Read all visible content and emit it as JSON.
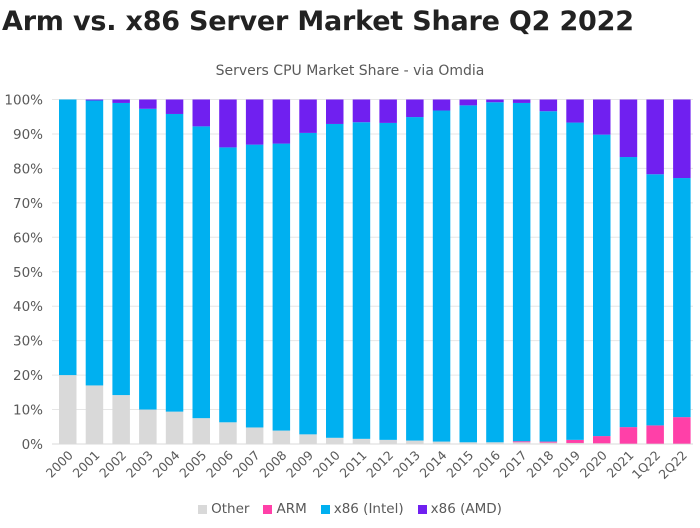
{
  "page": {
    "title": "Arm vs. x86 Server Market Share Q2 2022"
  },
  "chart_data": {
    "type": "bar",
    "stacked": true,
    "title": "Servers CPU Market Share - via Omdia",
    "xlabel": "",
    "ylabel": "",
    "ylim": [
      0,
      100
    ],
    "y_ticks": [
      "0%",
      "10%",
      "20%",
      "30%",
      "40%",
      "50%",
      "60%",
      "70%",
      "80%",
      "90%",
      "100%"
    ],
    "grid": true,
    "legend_position": "bottom",
    "categories": [
      "2000",
      "2001",
      "2002",
      "2003",
      "2004",
      "2005",
      "2006",
      "2007",
      "2008",
      "2009",
      "2010",
      "2011",
      "2012",
      "2013",
      "2014",
      "2015",
      "2016",
      "2017",
      "2018",
      "2019",
      "2020",
      "2021",
      "1Q22",
      "2Q22"
    ],
    "series": [
      {
        "name": "Other",
        "color": "#d9d9d9",
        "values": [
          20,
          17,
          14.2,
          10,
          9.4,
          7.5,
          6.3,
          4.8,
          3.9,
          2.8,
          1.8,
          1.5,
          1.2,
          1.0,
          0.7,
          0.5,
          0.5,
          0.5,
          0.4,
          0.3,
          0.2,
          0.1,
          0.1,
          0.1
        ]
      },
      {
        "name": "ARM",
        "color": "#ff40a8",
        "values": [
          0,
          0,
          0,
          0,
          0,
          0,
          0,
          0,
          0,
          0,
          0,
          0,
          0,
          0,
          0,
          0,
          0,
          0.3,
          0.3,
          0.9,
          2.1,
          4.8,
          5.3,
          7.7
        ]
      },
      {
        "name": "x86 (Intel)",
        "color": "#00b0f0",
        "values": [
          80,
          82.7,
          84.8,
          87.3,
          86.4,
          84.7,
          79.8,
          82.1,
          83.3,
          87.5,
          91.1,
          91.9,
          92.0,
          93.9,
          96.1,
          97.8,
          98.7,
          98.2,
          95.9,
          92.1,
          87.5,
          78.4,
          72.9,
          69.4
        ]
      },
      {
        "name": "x86 (AMD)",
        "color": "#7020f0",
        "values": [
          0,
          0.3,
          1.0,
          2.7,
          4.2,
          7.8,
          13.9,
          13.1,
          12.8,
          9.7,
          7.1,
          6.6,
          6.8,
          5.1,
          3.2,
          1.7,
          0.8,
          1.0,
          3.4,
          6.7,
          10.2,
          16.7,
          21.7,
          22.8
        ]
      }
    ]
  }
}
